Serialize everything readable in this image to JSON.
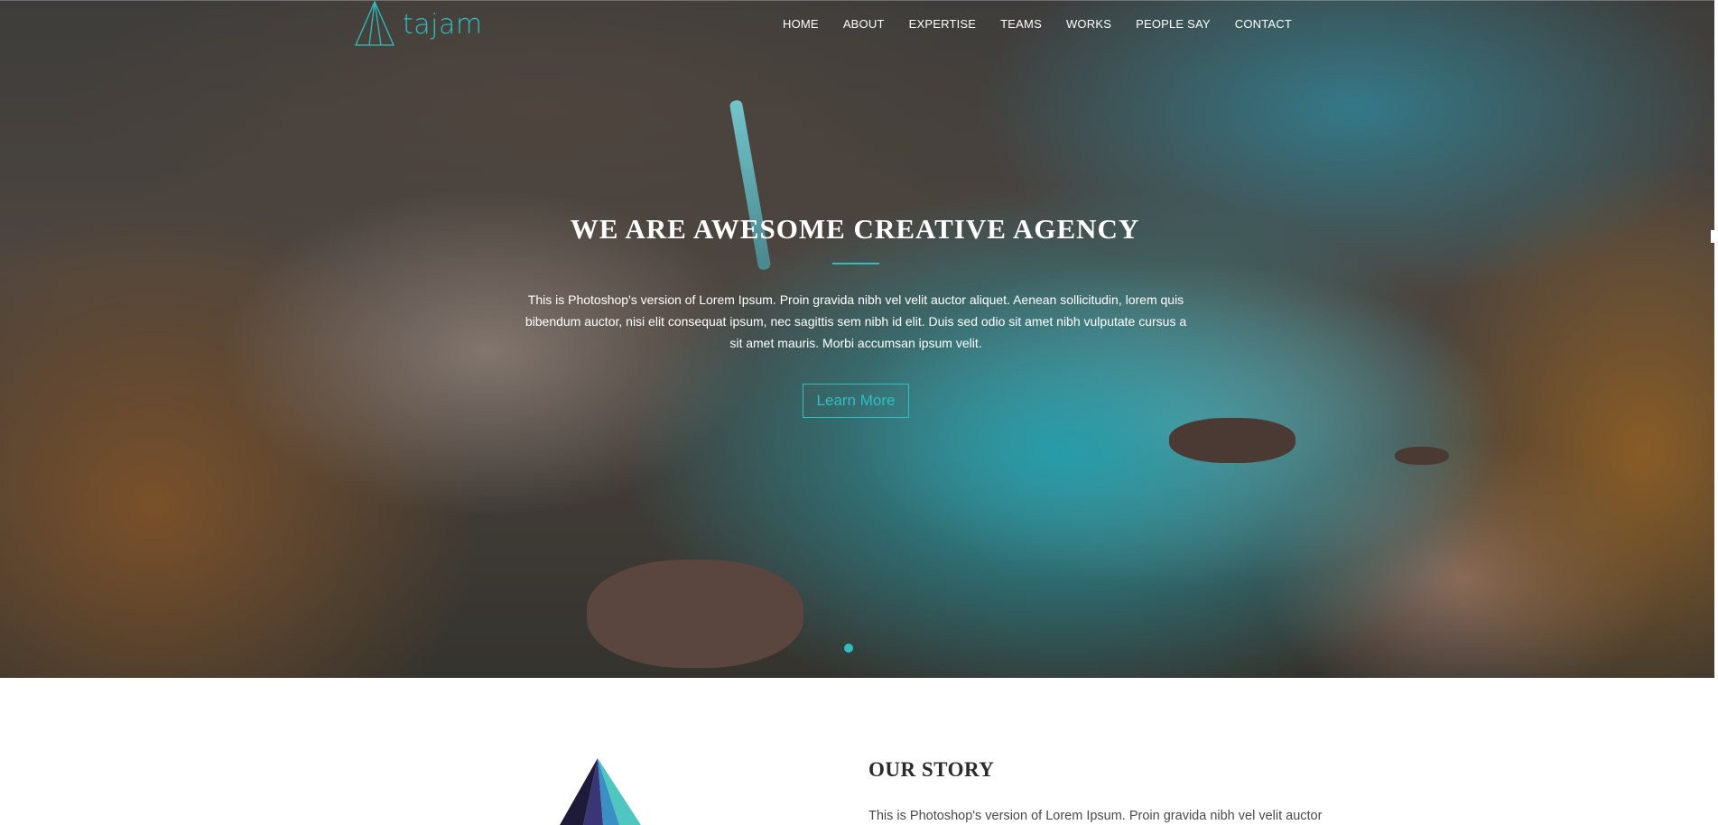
{
  "brand": {
    "name": "tajam",
    "logo_icon": "pyramid-outline-icon",
    "accent": "#2ebfbf"
  },
  "nav": {
    "items": [
      {
        "label": "HOME"
      },
      {
        "label": "ABOUT"
      },
      {
        "label": "EXPERTISE"
      },
      {
        "label": "TEAMS"
      },
      {
        "label": "WORKS"
      },
      {
        "label": "PEOPLE SAY"
      },
      {
        "label": "CONTACT"
      }
    ]
  },
  "hero": {
    "title": "WE ARE AWESOME CREATIVE AGENCY",
    "text": "This is Photoshop's version of Lorem Ipsum. Proin gravida nibh vel velit auctor aliquet. Aenean sollicitudin, lorem quis bibendum auctor, nisi elit consequat ipsum, nec sagittis sem nibh id elit. Duis sed odio sit amet nibh vulputate cursus a sit amet mauris. Morbi accumsan ipsum velit.",
    "button_label": "Learn More",
    "slider": {
      "count": 2,
      "active": 1
    }
  },
  "story": {
    "title": "OUR STORY",
    "text": "This is Photoshop's version of Lorem Ipsum. Proin gravida nibh vel velit auctor",
    "art_icon": "pyramid-icon",
    "colors": {
      "dark": "#1d1a3a",
      "mid": "#3a3577",
      "blue": "#3a8fc4",
      "teal": "#4fc6c0"
    }
  }
}
